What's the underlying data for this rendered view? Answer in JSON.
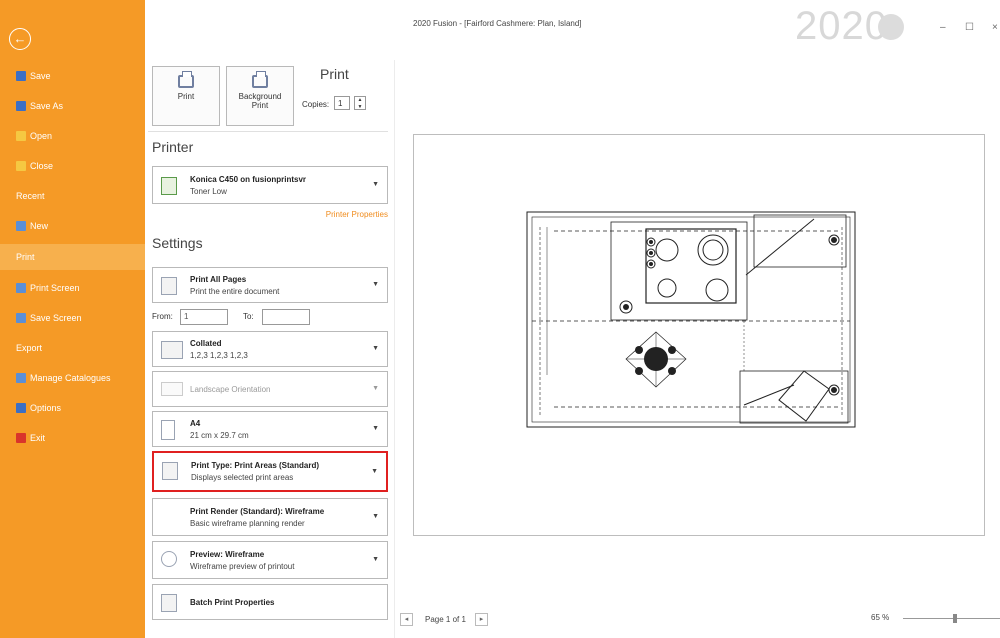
{
  "window": {
    "title": "2020 Fusion - [Fairford Cashmere: Plan, Island]",
    "logo": "2020",
    "min": "–",
    "max": "☐",
    "close": "×"
  },
  "sidebar": {
    "back": "←",
    "items": [
      {
        "label": "Save",
        "color": "#3c6fc4"
      },
      {
        "label": "Save As",
        "color": "#3c6fc4"
      },
      {
        "label": "Open",
        "color": "#f5c842"
      },
      {
        "label": "Close",
        "color": "#f5c842"
      },
      {
        "label": "Recent"
      },
      {
        "label": "New",
        "color": "#5b8fd6"
      },
      {
        "label": "Print"
      },
      {
        "label": "Print Screen",
        "color": "#5b8fd6"
      },
      {
        "label": "Save Screen",
        "color": "#5b8fd6"
      },
      {
        "label": "Export"
      },
      {
        "label": "Manage Catalogues",
        "color": "#5b8fd6"
      },
      {
        "label": "Options",
        "color": "#3c6fc4"
      },
      {
        "label": "Exit",
        "color": "#d9342b"
      }
    ]
  },
  "print": {
    "heading": "Print",
    "print_button": "Print",
    "background_print_line1": "Background",
    "background_print_line2": "Print",
    "copies_label": "Copies:",
    "copies_value": "1"
  },
  "printer": {
    "heading": "Printer",
    "name": "Konica C450 on fusionprintsvr",
    "status": "Toner Low",
    "properties_link": "Printer Properties"
  },
  "settings": {
    "heading": "Settings",
    "pages_title": "Print All Pages",
    "pages_desc": "Print the entire document",
    "from_label": "From:",
    "from_value": "1",
    "to_label": "To:",
    "to_value": "",
    "collate_title": "Collated",
    "collate_desc": "1,2,3  1,2,3  1,2,3",
    "orientation": "Landscape Orientation",
    "paper_title": "A4",
    "paper_desc": "21 cm x 29.7 cm",
    "type_title": "Print Type: Print Areas (Standard)",
    "type_desc": "Displays selected print areas",
    "render_title": "Print Render (Standard): Wireframe",
    "render_desc": "Basic wireframe planning render",
    "preview_title": "Preview: Wireframe",
    "preview_desc": "Wireframe preview of printout",
    "batch": "Batch Print Properties"
  },
  "preview": {
    "prev": "◂",
    "next": "▸",
    "page_text": "Page 1 of 1",
    "zoom": "65 %"
  }
}
